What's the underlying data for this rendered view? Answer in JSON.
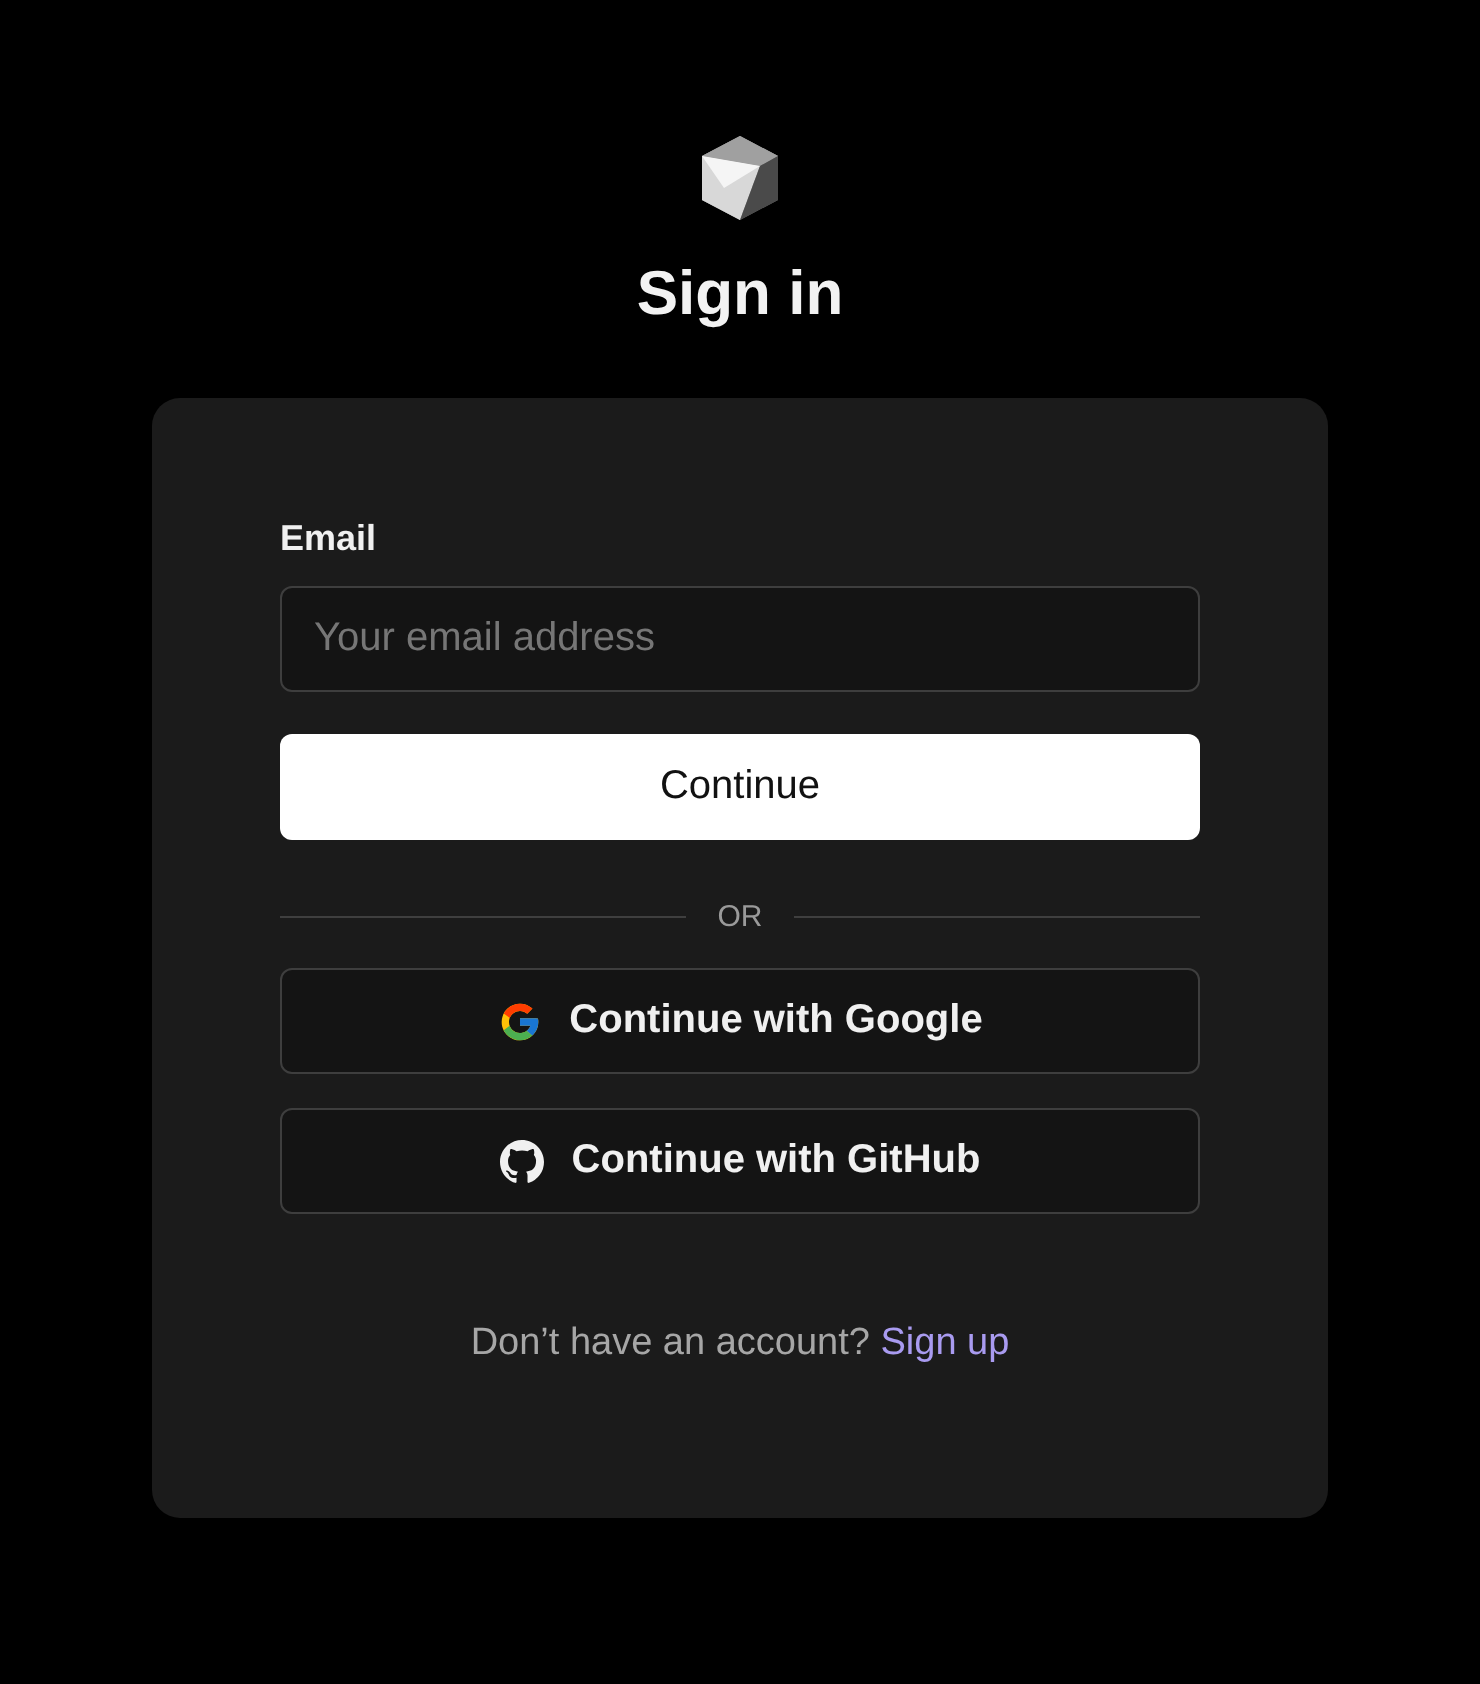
{
  "title": "Sign in",
  "form": {
    "email_label": "Email",
    "email_placeholder": "Your email address",
    "continue_button": "Continue"
  },
  "divider": "OR",
  "social_buttons": [
    {
      "kind": "google",
      "label": "Continue with Google"
    },
    {
      "kind": "github",
      "label": "Continue with GitHub"
    }
  ],
  "footer": {
    "text": "Don’t have an account?",
    "link": "Sign up"
  }
}
